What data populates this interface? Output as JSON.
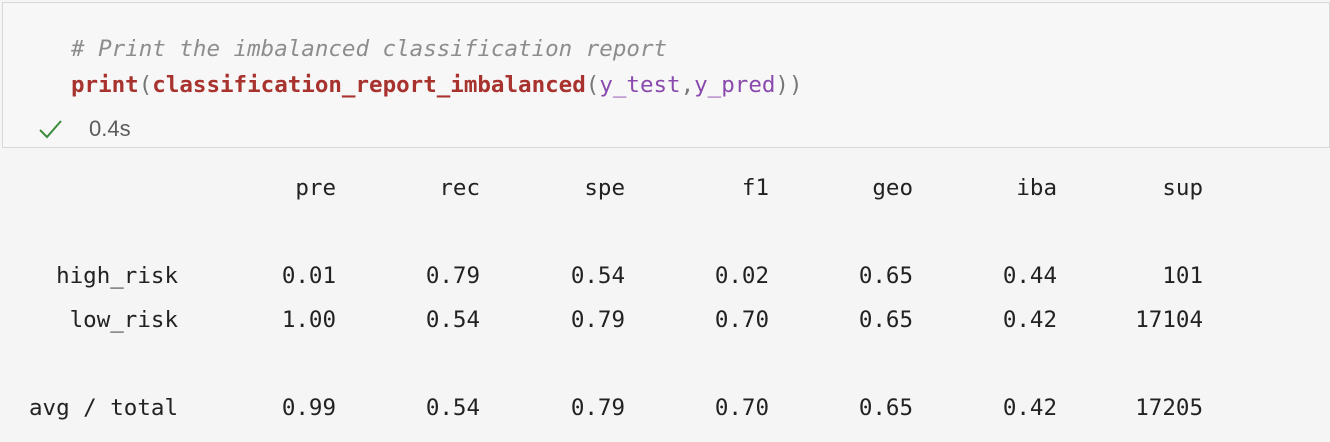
{
  "cell": {
    "comment": "# Print the imbalanced classification report",
    "code": {
      "kw": "print",
      "open1": "(",
      "fn": "classification_report_imbalanced",
      "open2": "(",
      "arg1": "y_test",
      "comma": ",",
      "arg2": "y_pred",
      "close": "))"
    },
    "status": {
      "icon": "check-icon",
      "duration": "0.4s",
      "color": "#3c8c3c"
    }
  },
  "report": {
    "headers": [
      "pre",
      "rec",
      "spe",
      "f1",
      "geo",
      "iba",
      "sup"
    ],
    "rows": [
      {
        "label": "high_risk",
        "values": [
          "0.01",
          "0.79",
          "0.54",
          "0.02",
          "0.65",
          "0.44",
          "101"
        ]
      },
      {
        "label": "low_risk",
        "values": [
          "1.00",
          "0.54",
          "0.79",
          "0.70",
          "0.65",
          "0.42",
          "17104"
        ]
      }
    ],
    "total": {
      "label": "avg / total",
      "values": [
        "0.99",
        "0.54",
        "0.79",
        "0.70",
        "0.65",
        "0.42",
        "17205"
      ]
    }
  }
}
